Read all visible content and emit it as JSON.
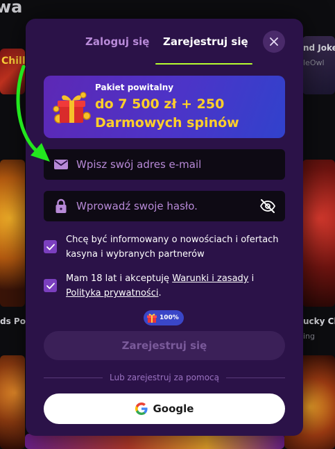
{
  "background": {
    "site_logo_fragment": "wa",
    "tiles": [
      {
        "label": "Chilli Joker fragment",
        "text": "Chill Jok"
      },
      {
        "label": "right top game title fragment",
        "text": "nd Joke"
      },
      {
        "label": "right top provider fragment",
        "text": "leOwl"
      },
      {
        "label": "left game title fragment",
        "text": "ds Pow"
      },
      {
        "label": "right game title fragment",
        "text": "ucky Cl"
      },
      {
        "label": "right provider fragment",
        "text": "ing"
      }
    ]
  },
  "tabs": {
    "login": "Zaloguj się",
    "register": "Zarejestruj się",
    "active": "register"
  },
  "close_icon": "close-icon",
  "promo": {
    "subtitle": "Pakiet powitalny",
    "headline": "do 7 500 zł + 250 Darmowych spinów",
    "icon": "gift-icon"
  },
  "form": {
    "email_placeholder": "Wpisz swój adres e-mail",
    "email_value": "",
    "password_placeholder": "Wprowadź swoje hasło.",
    "password_value": "",
    "password_visibility_icon": "eye-slash-icon"
  },
  "consents": {
    "marketing": {
      "text": "Chcę być informowany o nowościach i ofertach kasyna i wybranych partnerów",
      "checked": true
    },
    "terms": {
      "text_prefix": "Mam 18 lat i akceptuję ",
      "terms_link": "Warunki i zasady",
      "middle": " i ",
      "privacy_link": "Polityka prywatności",
      "suffix": ".",
      "checked": true
    }
  },
  "progress_badge": {
    "icon": "gift-icon",
    "value": "100%"
  },
  "submit_label": "Zarejestruj się",
  "alt_login": {
    "divider_text": "Lub zarejestruj za pomocą",
    "google_label": "Google"
  },
  "colors": {
    "modal_bg": "#2b1248",
    "accent_green": "#b6ff2f",
    "promo_yellow": "#ffcf2a",
    "link_purple": "#b88ad8",
    "checkbox_purple": "#7b3fbf",
    "pointer_arrow": "#22e61e"
  }
}
